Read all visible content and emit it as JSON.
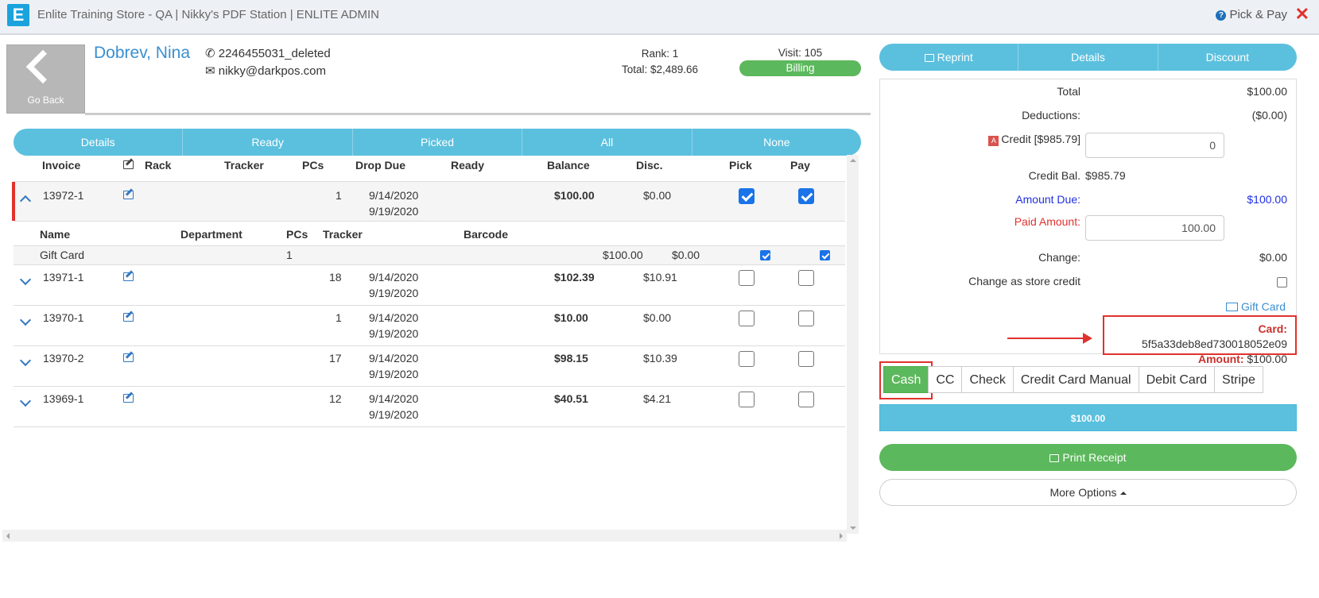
{
  "app": {
    "title": "Enlite Training Store - QA | Nikky's PDF Station | ENLITE ADMIN",
    "logo": "E",
    "pick_pay": "Pick & Pay"
  },
  "customer": {
    "go_back": "Go Back",
    "name": "Dobrev, Nina",
    "phone": "2246455031_deleted",
    "email": "nikky@darkpos.com",
    "rank": "Rank: 1",
    "total": "Total: $2,489.66",
    "visit": "Visit: 105",
    "status": "Billing"
  },
  "filters": [
    "Details",
    "Ready",
    "Picked",
    "All",
    "None"
  ],
  "table": {
    "headers": {
      "invoice": "Invoice",
      "rack": "Rack",
      "tracker": "Tracker",
      "pcs": "PCs",
      "drop_due": "Drop Due",
      "ready": "Ready",
      "balance": "Balance",
      "disc": "Disc.",
      "pick": "Pick",
      "pay": "Pay"
    },
    "sub_headers": {
      "name": "Name",
      "department": "Department",
      "pcs": "PCs",
      "tracker": "Tracker",
      "barcode": "Barcode"
    },
    "rows": [
      {
        "invoice": "13972-1",
        "pcs": "1",
        "drop": "9/14/2020",
        "due": "9/19/2020",
        "balance": "$100.00",
        "disc": "$0.00",
        "pick": true,
        "pay": true,
        "expanded": true
      },
      {
        "invoice": "13971-1",
        "pcs": "18",
        "drop": "9/14/2020",
        "due": "9/19/2020",
        "balance": "$102.39",
        "disc": "$10.91",
        "pick": false,
        "pay": false
      },
      {
        "invoice": "13970-1",
        "pcs": "1",
        "drop": "9/14/2020",
        "due": "9/19/2020",
        "balance": "$10.00",
        "disc": "$0.00",
        "pick": false,
        "pay": false
      },
      {
        "invoice": "13970-2",
        "pcs": "17",
        "drop": "9/14/2020",
        "due": "9/19/2020",
        "balance": "$98.15",
        "disc": "$10.39",
        "pick": false,
        "pay": false
      },
      {
        "invoice": "13969-1",
        "pcs": "12",
        "drop": "9/14/2020",
        "due": "9/19/2020",
        "balance": "$40.51",
        "disc": "$4.21",
        "pick": false,
        "pay": false
      }
    ],
    "sub_item": {
      "name": "Gift Card",
      "pcs": "1",
      "balance": "$100.00",
      "disc": "$0.00",
      "pick": true,
      "pay": true
    }
  },
  "actions": [
    "Reprint",
    "Details",
    "Discount"
  ],
  "payment": {
    "total_label": "Total",
    "total": "$100.00",
    "deductions_label": "Deductions:",
    "deductions": "($0.00)",
    "credit_label": "Credit [$985.79]",
    "credit_value": "0",
    "credit_bal_label": "Credit Bal.",
    "credit_bal": "$985.79",
    "amount_due_label": "Amount Due:",
    "amount_due": "$100.00",
    "paid_label": "Paid Amount:",
    "paid_value": "100.00",
    "change_label": "Change:",
    "change": "$0.00",
    "change_credit_label": "Change as store credit",
    "gift_card_link": "Gift Card",
    "card_label": "Card:",
    "card_number": "5f5a33deb8ed730018052e09",
    "amount_label": "Amount:",
    "amount": "$100.00"
  },
  "pay_methods": [
    "Cash",
    "CC",
    "Check",
    "Credit Card Manual",
    "Debit Card",
    "Stripe"
  ],
  "pay_amount": "$100.00",
  "print_receipt": "Print Receipt",
  "more_options": "More Options",
  "colors": {
    "accent": "#5bc0de",
    "success": "#5cb85c",
    "danger": "#e0322d",
    "link": "#3a8fd0"
  }
}
